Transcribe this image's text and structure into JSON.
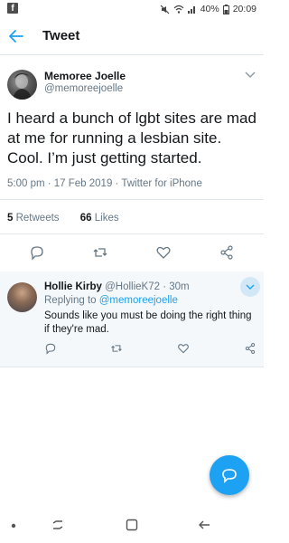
{
  "status_bar": {
    "battery": "40%",
    "time": "20:09",
    "notification_icon": "facebook-icon"
  },
  "header": {
    "title": "Tweet",
    "back_icon": "arrow-left-icon"
  },
  "tweet": {
    "author_name": "Memoree Joelle",
    "author_handle": "@memoreejoelle",
    "text": "I heard a bunch of lgbt sites are mad at me for running a lesbian site. Cool. I’m just getting started.",
    "meta": "5:00 pm · 17 Feb 2019 · Twitter for iPhone",
    "retweets_count": "5",
    "retweets_label": "Retweets",
    "likes_count": "66",
    "likes_label": "Likes"
  },
  "reply": {
    "author_name": "Hollie Kirby",
    "author_meta": "@HollieK72 · 30m",
    "replying_to_label": "Replying to",
    "replying_to_handle": "@memoreejoelle",
    "text": "Sounds like you must be doing the right thing if they're mad."
  },
  "colors": {
    "accent": "#1da1f2",
    "secondary_text": "#657786",
    "reply_background": "#f5f8fa"
  }
}
